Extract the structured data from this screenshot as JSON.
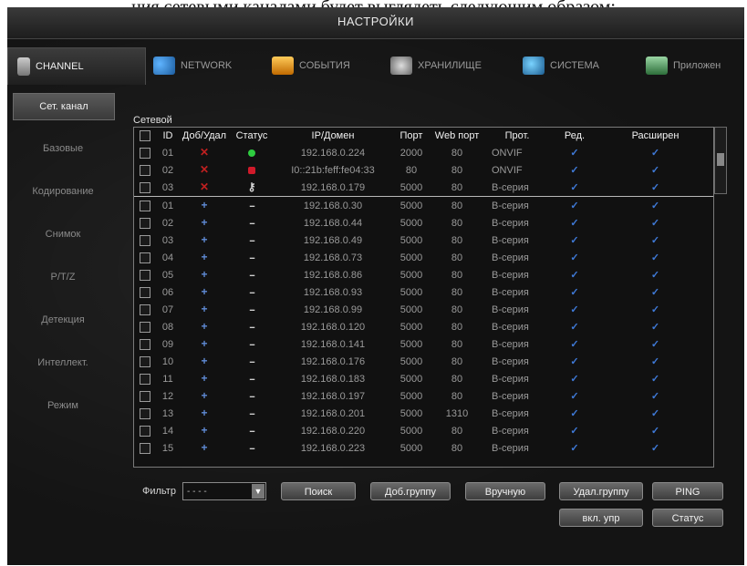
{
  "caption": "ния сетевыми каналами будет выглядеть следующим образом:",
  "window": {
    "title": "НАСТРОЙКИ"
  },
  "topnav": [
    {
      "label": "CHANNEL",
      "icon": "channel-icon",
      "active": true
    },
    {
      "label": "NETWORK",
      "icon": "network-icon"
    },
    {
      "label": "СОБЫТИЯ",
      "icon": "events-icon"
    },
    {
      "label": "ХРАНИЛИЩЕ",
      "icon": "storage-icon"
    },
    {
      "label": "СИСТЕМА",
      "icon": "system-icon"
    },
    {
      "label": "Приложен",
      "icon": "apps-icon"
    }
  ],
  "sidebar": [
    {
      "label": "Сет. канал",
      "active": true
    },
    {
      "label": "Базовые"
    },
    {
      "label": "Кодирование"
    },
    {
      "label": "Снимок"
    },
    {
      "label": "P/T/Z"
    },
    {
      "label": "Детекция"
    },
    {
      "label": "Интеллект."
    },
    {
      "label": "Режим"
    }
  ],
  "table": {
    "section_label": "Сетевой",
    "columns": [
      "",
      "ID",
      "Доб/Удал",
      "Статус",
      "IP/Домен",
      "Порт",
      "Web порт",
      "Прот.",
      "Ред.",
      "Расширен"
    ],
    "added_rows": [
      {
        "id": "01",
        "status": "ok",
        "ip": "192.168.0.224",
        "port": "2000",
        "web": "80",
        "proto": "ONVIF"
      },
      {
        "id": "02",
        "status": "error",
        "ip": "I0::21b:feff:fe04:33",
        "port": "80",
        "web": "80",
        "proto": "ONVIF"
      },
      {
        "id": "03",
        "status": "key",
        "ip": "192.168.0.179",
        "port": "5000",
        "web": "80",
        "proto": "B-серия"
      }
    ],
    "found_rows": [
      {
        "id": "01",
        "ip": "192.168.0.30",
        "port": "5000",
        "web": "80",
        "proto": "B-серия"
      },
      {
        "id": "02",
        "ip": "192.168.0.44",
        "port": "5000",
        "web": "80",
        "proto": "B-серия"
      },
      {
        "id": "03",
        "ip": "192.168.0.49",
        "port": "5000",
        "web": "80",
        "proto": "B-серия"
      },
      {
        "id": "04",
        "ip": "192.168.0.73",
        "port": "5000",
        "web": "80",
        "proto": "B-серия"
      },
      {
        "id": "05",
        "ip": "192.168.0.86",
        "port": "5000",
        "web": "80",
        "proto": "B-серия"
      },
      {
        "id": "06",
        "ip": "192.168.0.93",
        "port": "5000",
        "web": "80",
        "proto": "B-серия"
      },
      {
        "id": "07",
        "ip": "192.168.0.99",
        "port": "5000",
        "web": "80",
        "proto": "B-серия"
      },
      {
        "id": "08",
        "ip": "192.168.0.120",
        "port": "5000",
        "web": "80",
        "proto": "B-серия"
      },
      {
        "id": "09",
        "ip": "192.168.0.141",
        "port": "5000",
        "web": "80",
        "proto": "B-серия"
      },
      {
        "id": "10",
        "ip": "192.168.0.176",
        "port": "5000",
        "web": "80",
        "proto": "B-серия"
      },
      {
        "id": "11",
        "ip": "192.168.0.183",
        "port": "5000",
        "web": "80",
        "proto": "B-серия"
      },
      {
        "id": "12",
        "ip": "192.168.0.197",
        "port": "5000",
        "web": "80",
        "proto": "B-серия"
      },
      {
        "id": "13",
        "ip": "192.168.0.201",
        "port": "5000",
        "web": "1310",
        "proto": "B-серия"
      },
      {
        "id": "14",
        "ip": "192.168.0.220",
        "port": "5000",
        "web": "80",
        "proto": "B-серия"
      },
      {
        "id": "15",
        "ip": "192.168.0.223",
        "port": "5000",
        "web": "80",
        "proto": "B-серия"
      }
    ],
    "symbols": {
      "delete": "✕",
      "add": "+",
      "none": "--",
      "edit": "✓",
      "key": "⚷"
    },
    "colors": {
      "ok": "#2ecc40",
      "error": "#d01a2a",
      "edit": "#3f7ad8"
    }
  },
  "bottom": {
    "filter_label": "Фильтр",
    "filter_value": "- - - -",
    "buttons": {
      "search": "Поиск",
      "add_group": "Доб.группу",
      "manual": "Вручную",
      "del_group": "Удал.группу",
      "ping": "PING",
      "enable_control": "вкл. упр",
      "status": "Статус"
    }
  }
}
